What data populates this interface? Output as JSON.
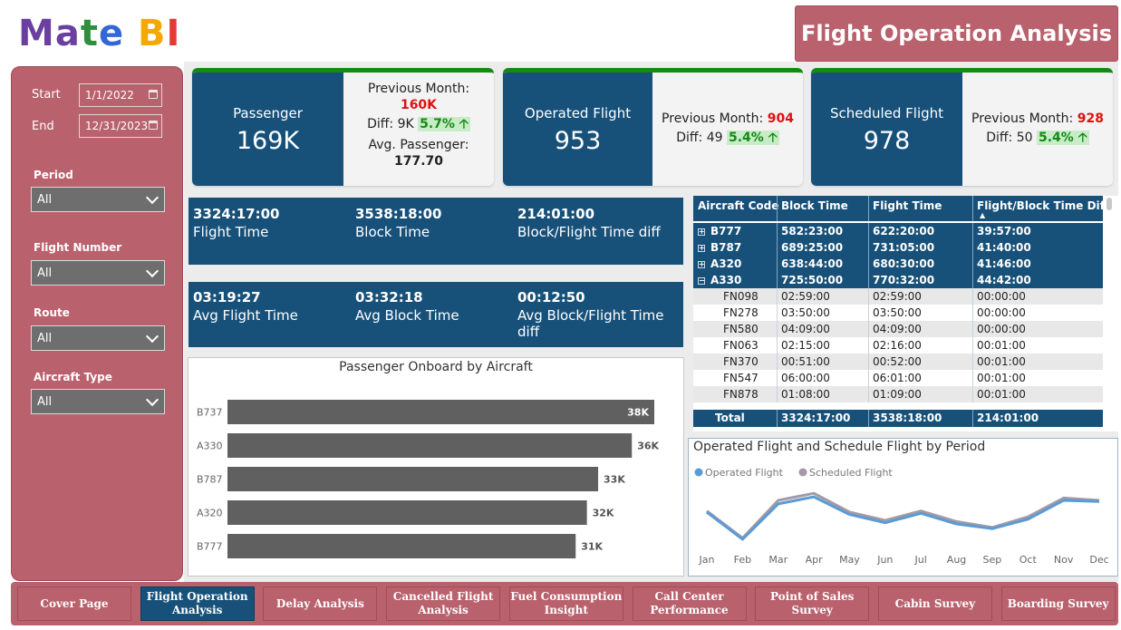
{
  "logo": {
    "letters": [
      "M",
      "a",
      "t",
      "e",
      " ",
      "B",
      "I"
    ],
    "colors": [
      "#6b3fa0",
      "#6b3fa0",
      "#2f8f3f",
      "#3367d6",
      "#ffffff",
      "#f2a900",
      "#e53935"
    ]
  },
  "title": "Flight Operation Analysis",
  "filters": {
    "start_label": "Start",
    "start_value": "1/1/2022",
    "end_label": "End",
    "end_value": "12/31/2023",
    "period_label": "Period",
    "period_value": "All",
    "flight_number_label": "Flight Number",
    "flight_number_value": "All",
    "route_label": "Route",
    "route_value": "All",
    "aircraft_type_label": "Aircraft Type",
    "aircraft_type_value": "All"
  },
  "kpis": {
    "passenger": {
      "label": "Passenger",
      "value": "169K",
      "prev_label": "Previous Month:",
      "prev_value": "160K",
      "diff_label": "Diff: 9K",
      "diff_pct": "5.7%",
      "avg_label": "Avg. Passenger:",
      "avg_value": "177.70"
    },
    "operated": {
      "label": "Operated Flight",
      "value": "953",
      "prev_label": "Previous Month:",
      "prev_value": "904",
      "diff_label": "Diff: 49",
      "diff_pct": "5.4%"
    },
    "scheduled": {
      "label": "Scheduled Flight",
      "value": "978",
      "prev_label": "Previous Month:",
      "prev_value": "928",
      "diff_label": "Diff: 50",
      "diff_pct": "5.4%"
    }
  },
  "times": {
    "flight_time": {
      "value": "3324:17:00",
      "label": "Flight Time"
    },
    "block_time": {
      "value": "3538:18:00",
      "label": "Block Time"
    },
    "diff": {
      "value": "214:01:00",
      "label": "Block/Flight Time diff"
    },
    "avg_flight": {
      "value": "03:19:27",
      "label": "Avg Flight Time"
    },
    "avg_block": {
      "value": "03:32:18",
      "label": "Avg Block Time"
    },
    "avg_diff": {
      "value": "00:12:50",
      "label": "Avg Block/Flight Time diff"
    }
  },
  "table": {
    "headers": [
      "Aircraft Code",
      "Block Time",
      "Flight Time",
      "Flight/Block Time Diff"
    ],
    "groups": [
      {
        "code": "B777",
        "block": "582:23:00",
        "flight": "622:20:00",
        "diff": "39:57:00",
        "expanded": false
      },
      {
        "code": "B787",
        "block": "689:25:00",
        "flight": "731:05:00",
        "diff": "41:40:00",
        "expanded": false
      },
      {
        "code": "A320",
        "block": "638:44:00",
        "flight": "680:30:00",
        "diff": "41:46:00",
        "expanded": false
      },
      {
        "code": "A330",
        "block": "725:50:00",
        "flight": "770:32:00",
        "diff": "44:42:00",
        "expanded": true
      }
    ],
    "details": [
      {
        "code": "FN098",
        "block": "02:59:00",
        "flight": "02:59:00",
        "diff": "00:00:00"
      },
      {
        "code": "FN278",
        "block": "03:50:00",
        "flight": "03:50:00",
        "diff": "00:00:00"
      },
      {
        "code": "FN580",
        "block": "04:09:00",
        "flight": "04:09:00",
        "diff": "00:00:00"
      },
      {
        "code": "FN063",
        "block": "02:15:00",
        "flight": "02:16:00",
        "diff": "00:01:00"
      },
      {
        "code": "FN370",
        "block": "00:51:00",
        "flight": "00:52:00",
        "diff": "00:01:00"
      },
      {
        "code": "FN547",
        "block": "06:00:00",
        "flight": "06:01:00",
        "diff": "00:01:00"
      },
      {
        "code": "FN878",
        "block": "01:08:00",
        "flight": "01:09:00",
        "diff": "00:01:00"
      }
    ],
    "total": {
      "label": "Total",
      "block": "3324:17:00",
      "flight": "3538:18:00",
      "diff": "214:01:00"
    }
  },
  "chart_data": [
    {
      "type": "bar",
      "title": "Passenger Onboard by Aircraft",
      "orientation": "horizontal",
      "categories": [
        "B737",
        "A330",
        "B787",
        "A320",
        "B777"
      ],
      "values": [
        38,
        36,
        33,
        32,
        31
      ],
      "value_labels": [
        "38K",
        "36K",
        "33K",
        "32K",
        "31K"
      ],
      "unit": "K",
      "xlim": [
        0,
        38
      ],
      "color": "#606060"
    },
    {
      "type": "line",
      "title": "Operated Flight and Schedule Flight by Period",
      "categories": [
        "Jan",
        "Feb",
        "Mar",
        "Apr",
        "May",
        "Jun",
        "Jul",
        "Aug",
        "Sep",
        "Oct",
        "Nov",
        "Dec"
      ],
      "series": [
        {
          "name": "Operated Flight",
          "color": "#5b9bd5",
          "values": [
            85,
            62,
            92,
            98,
            83,
            76,
            84,
            75,
            71,
            79,
            95,
            94
          ]
        },
        {
          "name": "Scheduled Flight",
          "color": "#a39aa6",
          "values": [
            86,
            63,
            95,
            101,
            85,
            78,
            86,
            77,
            72,
            81,
            97,
            95
          ]
        }
      ],
      "ylim": [
        55,
        105
      ],
      "legend": "top-left"
    }
  ],
  "nav": [
    {
      "label": "Cover Page",
      "active": false
    },
    {
      "label": "Flight Operation Analysis",
      "active": true
    },
    {
      "label": "Delay Analysis",
      "active": false
    },
    {
      "label": "Cancelled Flight Analysis",
      "active": false
    },
    {
      "label": "Fuel Consumption Insight",
      "active": false
    },
    {
      "label": "Call Center Performance",
      "active": false
    },
    {
      "label": "Point of Sales Survey",
      "active": false
    },
    {
      "label": "Cabin Survey",
      "active": false
    },
    {
      "label": "Boarding Survey",
      "active": false
    }
  ]
}
